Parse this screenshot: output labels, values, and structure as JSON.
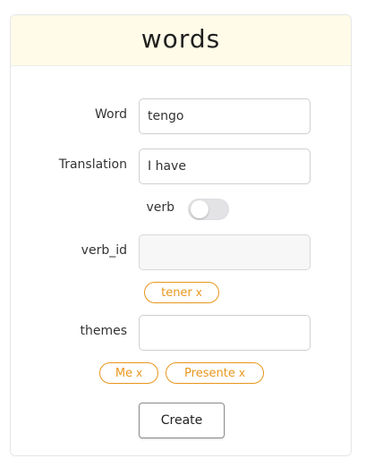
{
  "header": {
    "title": "words"
  },
  "form": {
    "word": {
      "label": "Word",
      "value": "tengo"
    },
    "translation": {
      "label": "Translation",
      "value": "I have"
    },
    "verb": {
      "label": "verb",
      "checked": false
    },
    "verb_id": {
      "label": "verb_id",
      "value": ""
    },
    "verb_tags": [
      {
        "label": "tener",
        "remove": "x"
      }
    ],
    "themes": {
      "label": "themes",
      "value": ""
    },
    "theme_tags": [
      {
        "label": "Me",
        "remove": "x"
      },
      {
        "label": "Presente",
        "remove": "x"
      }
    ],
    "submit_label": "Create"
  },
  "colors": {
    "header_bg": "#fffbe8",
    "chip": "#e8961c",
    "border": "#cfcfcf"
  }
}
